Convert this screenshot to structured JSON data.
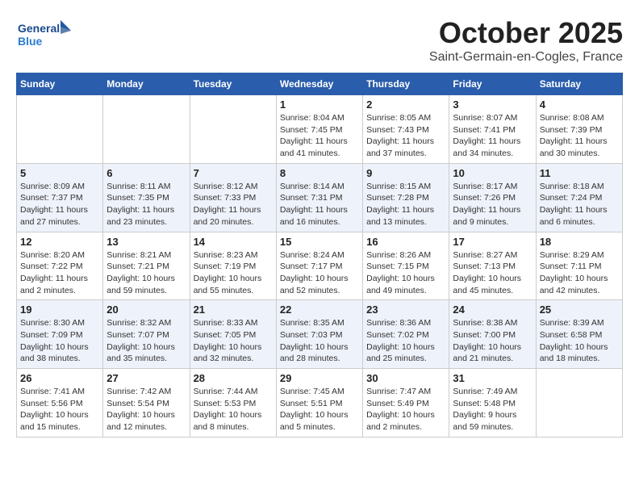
{
  "header": {
    "logo_general": "General",
    "logo_blue": "Blue",
    "month_title": "October 2025",
    "location": "Saint-Germain-en-Cogles, France"
  },
  "weekdays": [
    "Sunday",
    "Monday",
    "Tuesday",
    "Wednesday",
    "Thursday",
    "Friday",
    "Saturday"
  ],
  "weeks": [
    [
      {
        "day": "",
        "info": ""
      },
      {
        "day": "",
        "info": ""
      },
      {
        "day": "",
        "info": ""
      },
      {
        "day": "1",
        "info": "Sunrise: 8:04 AM\nSunset: 7:45 PM\nDaylight: 11 hours\nand 41 minutes."
      },
      {
        "day": "2",
        "info": "Sunrise: 8:05 AM\nSunset: 7:43 PM\nDaylight: 11 hours\nand 37 minutes."
      },
      {
        "day": "3",
        "info": "Sunrise: 8:07 AM\nSunset: 7:41 PM\nDaylight: 11 hours\nand 34 minutes."
      },
      {
        "day": "4",
        "info": "Sunrise: 8:08 AM\nSunset: 7:39 PM\nDaylight: 11 hours\nand 30 minutes."
      }
    ],
    [
      {
        "day": "5",
        "info": "Sunrise: 8:09 AM\nSunset: 7:37 PM\nDaylight: 11 hours\nand 27 minutes."
      },
      {
        "day": "6",
        "info": "Sunrise: 8:11 AM\nSunset: 7:35 PM\nDaylight: 11 hours\nand 23 minutes."
      },
      {
        "day": "7",
        "info": "Sunrise: 8:12 AM\nSunset: 7:33 PM\nDaylight: 11 hours\nand 20 minutes."
      },
      {
        "day": "8",
        "info": "Sunrise: 8:14 AM\nSunset: 7:31 PM\nDaylight: 11 hours\nand 16 minutes."
      },
      {
        "day": "9",
        "info": "Sunrise: 8:15 AM\nSunset: 7:28 PM\nDaylight: 11 hours\nand 13 minutes."
      },
      {
        "day": "10",
        "info": "Sunrise: 8:17 AM\nSunset: 7:26 PM\nDaylight: 11 hours\nand 9 minutes."
      },
      {
        "day": "11",
        "info": "Sunrise: 8:18 AM\nSunset: 7:24 PM\nDaylight: 11 hours\nand 6 minutes."
      }
    ],
    [
      {
        "day": "12",
        "info": "Sunrise: 8:20 AM\nSunset: 7:22 PM\nDaylight: 11 hours\nand 2 minutes."
      },
      {
        "day": "13",
        "info": "Sunrise: 8:21 AM\nSunset: 7:21 PM\nDaylight: 10 hours\nand 59 minutes."
      },
      {
        "day": "14",
        "info": "Sunrise: 8:23 AM\nSunset: 7:19 PM\nDaylight: 10 hours\nand 55 minutes."
      },
      {
        "day": "15",
        "info": "Sunrise: 8:24 AM\nSunset: 7:17 PM\nDaylight: 10 hours\nand 52 minutes."
      },
      {
        "day": "16",
        "info": "Sunrise: 8:26 AM\nSunset: 7:15 PM\nDaylight: 10 hours\nand 49 minutes."
      },
      {
        "day": "17",
        "info": "Sunrise: 8:27 AM\nSunset: 7:13 PM\nDaylight: 10 hours\nand 45 minutes."
      },
      {
        "day": "18",
        "info": "Sunrise: 8:29 AM\nSunset: 7:11 PM\nDaylight: 10 hours\nand 42 minutes."
      }
    ],
    [
      {
        "day": "19",
        "info": "Sunrise: 8:30 AM\nSunset: 7:09 PM\nDaylight: 10 hours\nand 38 minutes."
      },
      {
        "day": "20",
        "info": "Sunrise: 8:32 AM\nSunset: 7:07 PM\nDaylight: 10 hours\nand 35 minutes."
      },
      {
        "day": "21",
        "info": "Sunrise: 8:33 AM\nSunset: 7:05 PM\nDaylight: 10 hours\nand 32 minutes."
      },
      {
        "day": "22",
        "info": "Sunrise: 8:35 AM\nSunset: 7:03 PM\nDaylight: 10 hours\nand 28 minutes."
      },
      {
        "day": "23",
        "info": "Sunrise: 8:36 AM\nSunset: 7:02 PM\nDaylight: 10 hours\nand 25 minutes."
      },
      {
        "day": "24",
        "info": "Sunrise: 8:38 AM\nSunset: 7:00 PM\nDaylight: 10 hours\nand 21 minutes."
      },
      {
        "day": "25",
        "info": "Sunrise: 8:39 AM\nSunset: 6:58 PM\nDaylight: 10 hours\nand 18 minutes."
      }
    ],
    [
      {
        "day": "26",
        "info": "Sunrise: 7:41 AM\nSunset: 5:56 PM\nDaylight: 10 hours\nand 15 minutes."
      },
      {
        "day": "27",
        "info": "Sunrise: 7:42 AM\nSunset: 5:54 PM\nDaylight: 10 hours\nand 12 minutes."
      },
      {
        "day": "28",
        "info": "Sunrise: 7:44 AM\nSunset: 5:53 PM\nDaylight: 10 hours\nand 8 minutes."
      },
      {
        "day": "29",
        "info": "Sunrise: 7:45 AM\nSunset: 5:51 PM\nDaylight: 10 hours\nand 5 minutes."
      },
      {
        "day": "30",
        "info": "Sunrise: 7:47 AM\nSunset: 5:49 PM\nDaylight: 10 hours\nand 2 minutes."
      },
      {
        "day": "31",
        "info": "Sunrise: 7:49 AM\nSunset: 5:48 PM\nDaylight: 9 hours\nand 59 minutes."
      },
      {
        "day": "",
        "info": ""
      }
    ]
  ]
}
